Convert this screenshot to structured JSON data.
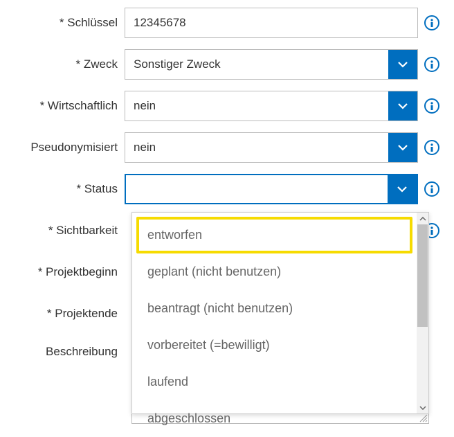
{
  "colors": {
    "accent": "#006ebf",
    "highlight": "#f6db00"
  },
  "form": {
    "key": {
      "label": "* Schlüssel",
      "value": "12345678"
    },
    "purpose": {
      "label": "* Zweck",
      "value": "Sonstiger Zweck"
    },
    "commercial": {
      "label": "* Wirtschaftlich",
      "value": "nein"
    },
    "pseudonymized": {
      "label": "Pseudonymisiert",
      "value": "nein"
    },
    "status": {
      "label": "* Status",
      "value": ""
    },
    "visibility": {
      "label": "* Sichtbarkeit"
    },
    "project_start": {
      "label": "* Projektbeginn"
    },
    "project_end": {
      "label": "* Projektende"
    },
    "description": {
      "label": "Beschreibung"
    }
  },
  "status_options": [
    {
      "label": "entworfen",
      "highlighted": true
    },
    {
      "label": "geplant (nicht benutzen)",
      "highlighted": false
    },
    {
      "label": "beantragt (nicht benutzen)",
      "highlighted": false
    },
    {
      "label": "vorbereitet (=bewilligt)",
      "highlighted": false
    },
    {
      "label": "laufend",
      "highlighted": false
    },
    {
      "label": "abgeschlossen",
      "highlighted": false
    }
  ]
}
